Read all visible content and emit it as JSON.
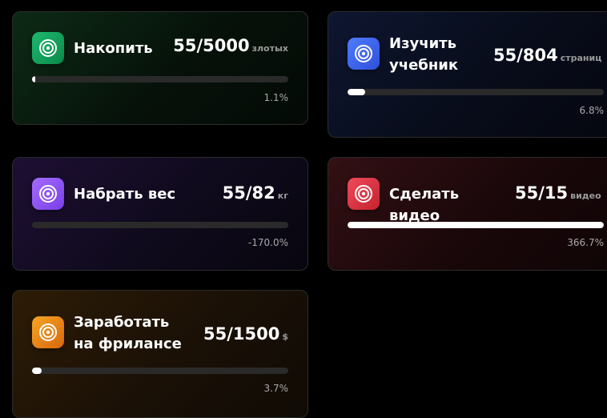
{
  "goals": [
    {
      "title": "Накопить",
      "value": "55/5000",
      "unit": "злотых",
      "percent": "1.1%",
      "progress": 0.011,
      "color": "#1fb870",
      "icon": "target-icon"
    },
    {
      "title": "Изучить учебник",
      "value": "55/804",
      "unit": "страниц",
      "percent": "6.8%",
      "progress": 0.068,
      "color": "#4f7cff",
      "icon": "target-icon"
    },
    {
      "title": "Набрать вес",
      "value": "55/82",
      "unit": "кг",
      "percent": "-170.0%",
      "progress": 0,
      "color": "#a36bff",
      "icon": "target-icon"
    },
    {
      "title": "Сделать видео",
      "value": "55/15",
      "unit": "видео",
      "percent": "366.7%",
      "progress": 1.0,
      "color": "#ef4a5a",
      "icon": "target-icon"
    },
    {
      "title": "Заработать на фрилансе",
      "value": "55/1500",
      "unit": "$",
      "percent": "3.7%",
      "progress": 0.037,
      "color": "#f5a524",
      "icon": "target-icon"
    }
  ]
}
